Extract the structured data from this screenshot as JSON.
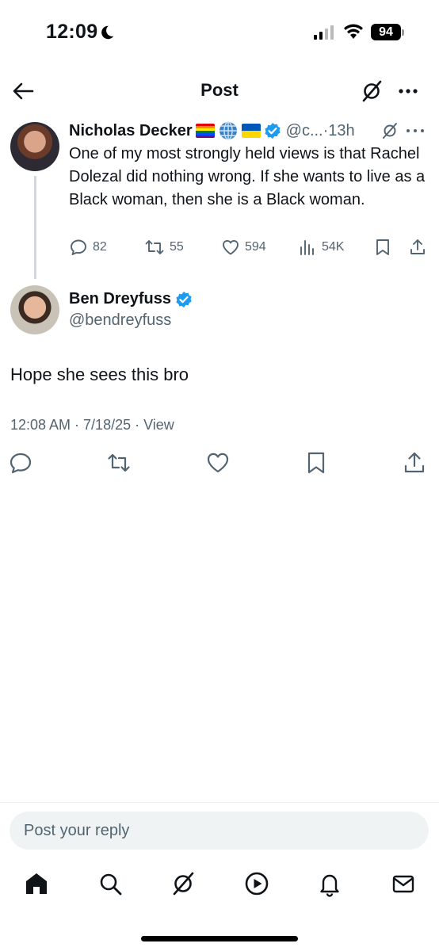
{
  "status_bar": {
    "time": "12:09",
    "battery": "94"
  },
  "header": {
    "title": "Post"
  },
  "parent_tweet": {
    "author_name": "Nicholas Decker",
    "handle": "@c...",
    "time": "·13h",
    "text": "One of my most strongly held views is that Rachel Dolezal did nothing wrong. If she wants to live as a Black woman, then she is a Black woman.",
    "replies": "82",
    "reposts": "55",
    "likes": "594",
    "views": "54K"
  },
  "main_tweet": {
    "author_name": "Ben Dreyfuss",
    "handle": "@bendreyfuss",
    "text": "Hope she sees this bro",
    "meta": "12:08 AM · 7/18/25 · View"
  },
  "reply": {
    "placeholder": "Post your reply"
  },
  "colors": {
    "text": "#0f1419",
    "secondary": "#536471",
    "verified": "#1d9bf0",
    "divider": "#eff3f4"
  }
}
